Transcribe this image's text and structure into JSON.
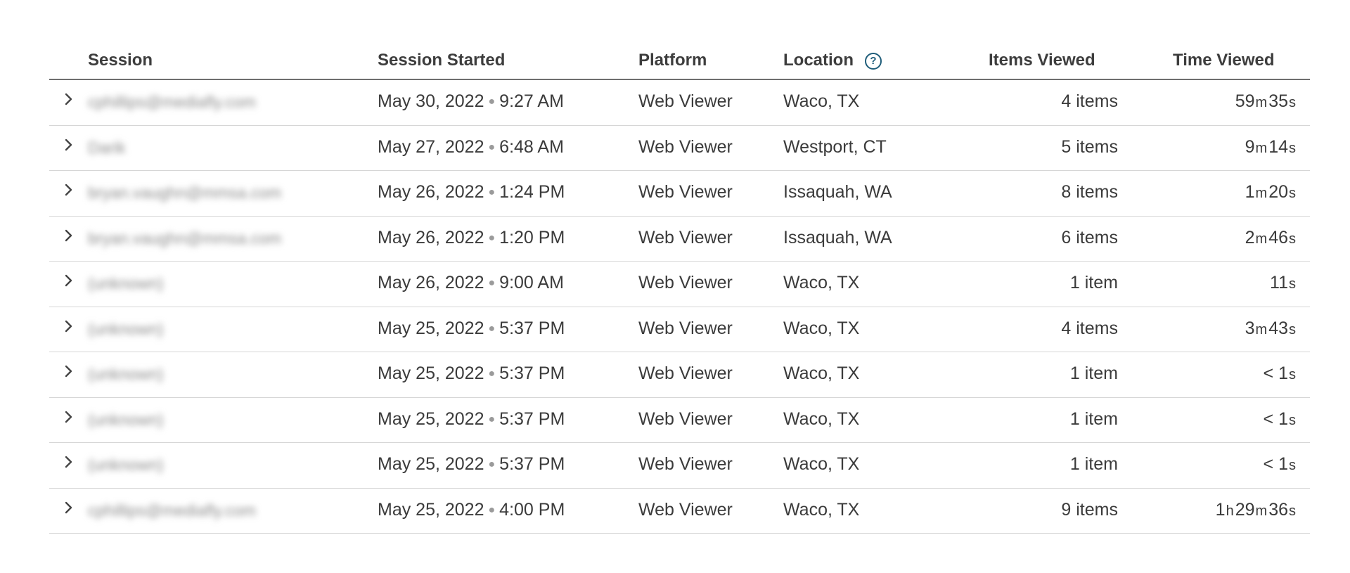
{
  "columns": {
    "session": "Session",
    "started": "Session Started",
    "platform": "Platform",
    "location": "Location",
    "items": "Items Viewed",
    "time": "Time Viewed"
  },
  "help_icon_glyph": "?",
  "accent_color": "#1f5d7a",
  "rows": [
    {
      "session": "cphillips@mediafly.com",
      "date": "May 30, 2022",
      "time": "9:27 AM",
      "platform": "Web Viewer",
      "location": "Waco, TX",
      "items": "4 items",
      "duration": [
        {
          "n": "59",
          "u": "m"
        },
        {
          "n": "35",
          "u": "s"
        }
      ]
    },
    {
      "session": "Darik",
      "date": "May 27, 2022",
      "time": "6:48 AM",
      "platform": "Web Viewer",
      "location": "Westport, CT",
      "items": "5 items",
      "duration": [
        {
          "n": "9",
          "u": "m"
        },
        {
          "n": "14",
          "u": "s"
        }
      ]
    },
    {
      "session": "bryan.vaughn@mmsa.com",
      "date": "May 26, 2022",
      "time": "1:24 PM",
      "platform": "Web Viewer",
      "location": "Issaquah, WA",
      "items": "8 items",
      "duration": [
        {
          "n": "1",
          "u": "m"
        },
        {
          "n": "20",
          "u": "s"
        }
      ]
    },
    {
      "session": "bryan.vaughn@mmsa.com",
      "date": "May 26, 2022",
      "time": "1:20 PM",
      "platform": "Web Viewer",
      "location": "Issaquah, WA",
      "items": "6 items",
      "duration": [
        {
          "n": "2",
          "u": "m"
        },
        {
          "n": "46",
          "u": "s"
        }
      ]
    },
    {
      "session": "(unknown)",
      "date": "May 26, 2022",
      "time": "9:00 AM",
      "platform": "Web Viewer",
      "location": "Waco, TX",
      "items": "1 item",
      "duration": [
        {
          "n": "11",
          "u": "s"
        }
      ]
    },
    {
      "session": "(unknown)",
      "date": "May 25, 2022",
      "time": "5:37 PM",
      "platform": "Web Viewer",
      "location": "Waco, TX",
      "items": "4 items",
      "duration": [
        {
          "n": "3",
          "u": "m"
        },
        {
          "n": "43",
          "u": "s"
        }
      ]
    },
    {
      "session": "(unknown)",
      "date": "May 25, 2022",
      "time": "5:37 PM",
      "platform": "Web Viewer",
      "location": "Waco, TX",
      "items": "1 item",
      "duration": [
        {
          "n": "< 1",
          "u": "s"
        }
      ]
    },
    {
      "session": "(unknown)",
      "date": "May 25, 2022",
      "time": "5:37 PM",
      "platform": "Web Viewer",
      "location": "Waco, TX",
      "items": "1 item",
      "duration": [
        {
          "n": "< 1",
          "u": "s"
        }
      ]
    },
    {
      "session": "(unknown)",
      "date": "May 25, 2022",
      "time": "5:37 PM",
      "platform": "Web Viewer",
      "location": "Waco, TX",
      "items": "1 item",
      "duration": [
        {
          "n": "< 1",
          "u": "s"
        }
      ]
    },
    {
      "session": "cphillips@mediafly.com",
      "date": "May 25, 2022",
      "time": "4:00 PM",
      "platform": "Web Viewer",
      "location": "Waco, TX",
      "items": "9 items",
      "duration": [
        {
          "n": "1",
          "u": "h"
        },
        {
          "n": "29",
          "u": "m"
        },
        {
          "n": "36",
          "u": "s"
        }
      ]
    }
  ]
}
